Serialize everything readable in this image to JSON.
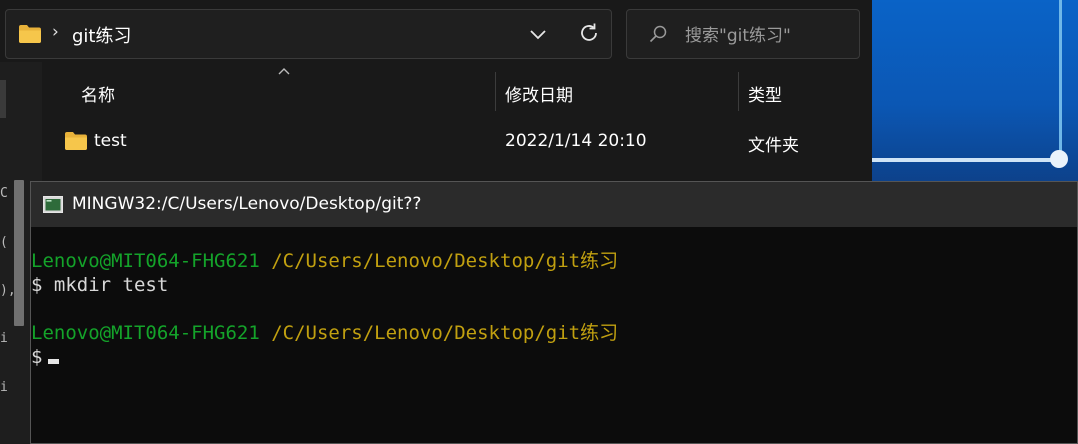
{
  "explorer": {
    "breadcrumb": {
      "separator": "›",
      "folder": "git练习"
    },
    "search": {
      "placeholder": "搜索\"git练习\""
    },
    "columns": {
      "name": "名称",
      "date_modified": "修改日期",
      "type": "类型"
    },
    "files": [
      {
        "name": "test",
        "date_modified": "2022/1/14 20:10",
        "type": "文件夹"
      }
    ],
    "left_edge_glyphs": [
      "C",
      "(",
      "),",
      "i",
      "i"
    ]
  },
  "terminal": {
    "title": "MINGW32:/C/Users/Lenovo/Desktop/git??",
    "lines": [
      {
        "user": "Lenovo@MIT064-FHG621",
        "path": " /C/Users/Lenovo/Desktop/git练习"
      },
      {
        "prompt": "$",
        "command": " mkdir test"
      },
      {
        "blank": ""
      },
      {
        "user": "Lenovo@MIT064-FHG621",
        "path": " /C/Users/Lenovo/Desktop/git练习"
      },
      {
        "prompt": "$",
        "command": " "
      }
    ]
  },
  "colors": {
    "terminal_user": "#14a32a",
    "terminal_path": "#c1a010",
    "folder_yellow": "#f6c64b",
    "wallpaper_blue": "#0b57b4"
  },
  "icons": {
    "folder": "folder-icon",
    "dropdown": "chevron-down-icon",
    "refresh": "refresh-icon",
    "search": "search-icon",
    "sort": "sort-up-icon",
    "terminal": "terminal-icon"
  }
}
